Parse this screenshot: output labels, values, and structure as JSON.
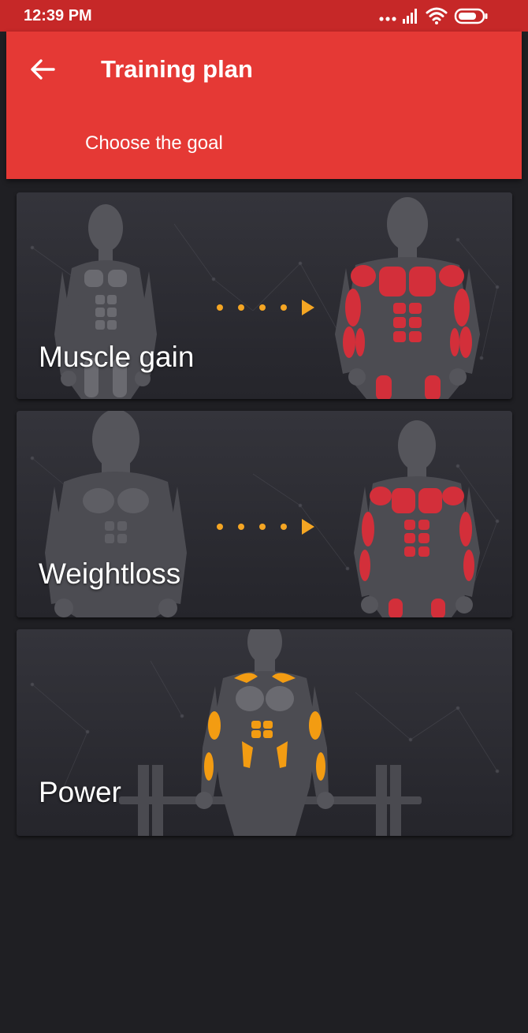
{
  "status_bar": {
    "time": "12:39 PM"
  },
  "app_bar": {
    "title": "Training plan",
    "subtitle": "Choose the goal"
  },
  "goals": [
    {
      "label": "Muscle gain"
    },
    {
      "label": "Weightloss"
    },
    {
      "label": "Power"
    }
  ],
  "colors": {
    "status_bar": "#c62828",
    "app_bar": "#e53935",
    "card": "#2a2a30",
    "muscle_red": "#d32f3a",
    "muscle_orange": "#f39c12",
    "body_dark": "#4a4a4f",
    "body_light": "#6e6e74",
    "background": "#1f1f23"
  },
  "icons": {
    "back": "arrow-left-icon",
    "signal": "cellular-signal-icon",
    "wifi": "wifi-icon",
    "battery": "battery-icon"
  }
}
